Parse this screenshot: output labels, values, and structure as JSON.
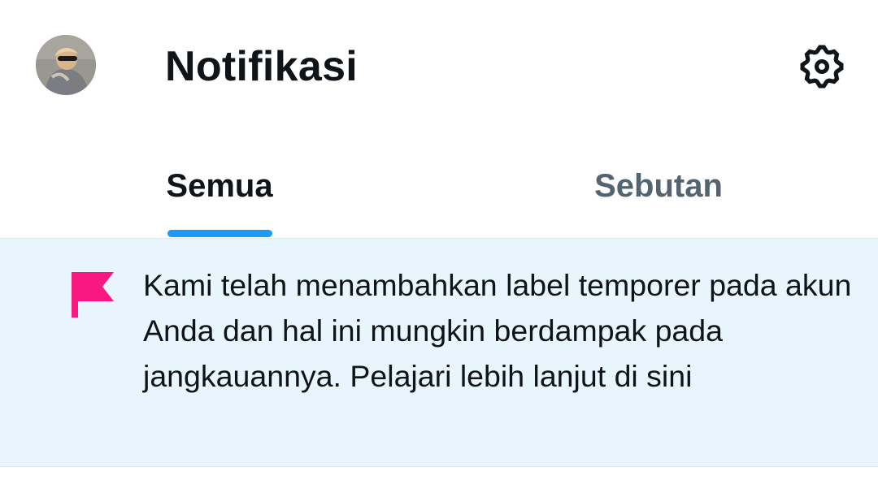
{
  "header": {
    "title": "Notifikasi",
    "avatar_icon": "profile-avatar",
    "settings_icon": "gear-icon"
  },
  "tabs": [
    {
      "label": "Semua",
      "selected": true
    },
    {
      "label": "Sebutan",
      "selected": false
    }
  ],
  "notice": {
    "icon": "flag-icon",
    "icon_color": "#f91880",
    "text": "Kami telah menambahkan label temporer pada akun Anda dan hal ini mungkin berdampak pada jangkauannya. Pelajari lebih lanjut di sini",
    "background": "#e8f5fd"
  },
  "colors": {
    "accent": "#1d9bf0",
    "text_primary": "#0f1419",
    "text_secondary": "#536471"
  }
}
